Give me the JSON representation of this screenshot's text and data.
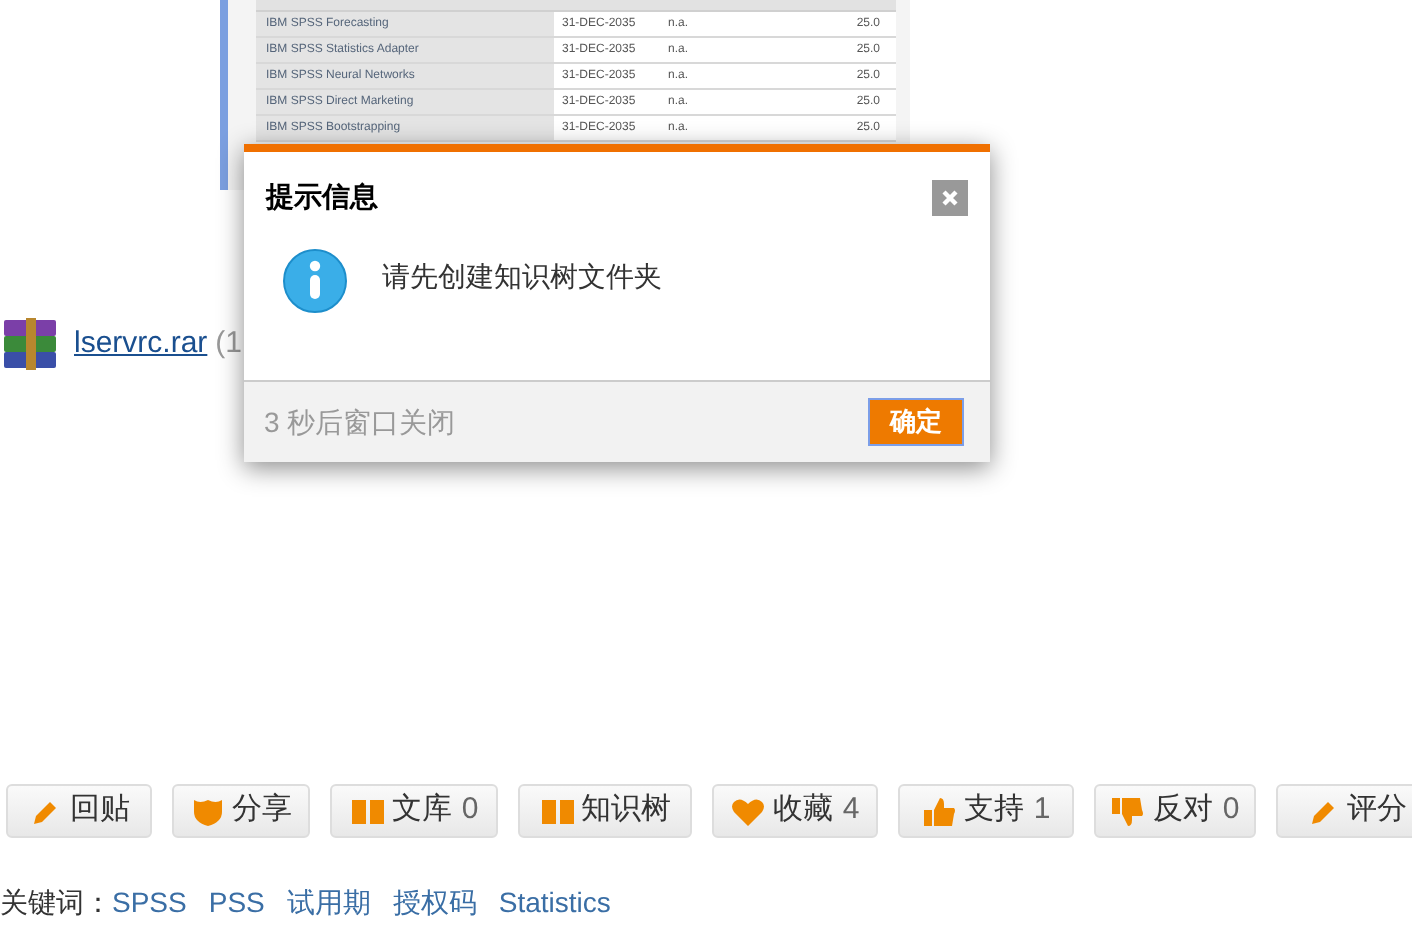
{
  "embedded_table": {
    "rows": [
      {
        "product": "IBM SPSS Forecasting",
        "expires": "31-DEC-2035",
        "column_3": "n.a.",
        "version": "25.0"
      },
      {
        "product": "IBM SPSS Statistics Adapter",
        "expires": "31-DEC-2035",
        "column_3": "n.a.",
        "version": "25.0"
      },
      {
        "product": "IBM SPSS Neural Networks",
        "expires": "31-DEC-2035",
        "column_3": "n.a.",
        "version": "25.0"
      },
      {
        "product": "IBM SPSS Direct Marketing",
        "expires": "31-DEC-2035",
        "column_3": "n.a.",
        "version": "25.0"
      },
      {
        "product": "IBM SPSS Bootstrapping",
        "expires": "31-DEC-2035",
        "column_3": "n.a.",
        "version": "25.0"
      }
    ]
  },
  "attachment": {
    "name": "lservrc.rar",
    "size": "(1"
  },
  "dialog": {
    "title": "提示信息",
    "message": "请先创建知识树文件夹",
    "countdown": "3 秒后窗口关闭",
    "ok_button": "确定"
  },
  "action_buttons": [
    {
      "kind": "pencil",
      "label": "回贴"
    },
    {
      "kind": "share",
      "label": "分享"
    },
    {
      "kind": "book",
      "label": "文库",
      "count": "0"
    },
    {
      "kind": "book",
      "label": "知识树"
    },
    {
      "kind": "heart",
      "label": "收藏",
      "count": "4"
    },
    {
      "kind": "thumbs-up",
      "label": "支持",
      "count": "1"
    },
    {
      "kind": "thumbs-down",
      "label": "反对",
      "count": "0"
    },
    {
      "kind": "pencil",
      "label": "评分"
    }
  ],
  "keywords": {
    "label": "关键词：",
    "items": [
      "SPSS",
      "PSS",
      "试用期",
      "授权码",
      "Statistics"
    ]
  }
}
